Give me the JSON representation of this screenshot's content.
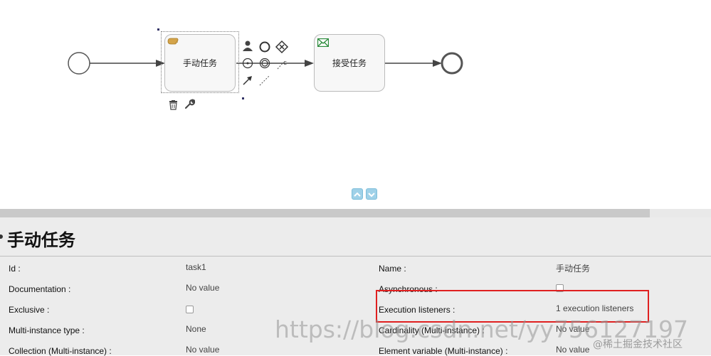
{
  "diagram": {
    "tasks": [
      {
        "id": "manual",
        "label": "手动任务"
      },
      {
        "id": "receive",
        "label": "接受任务"
      }
    ],
    "toolbar_icons": [
      "user-icon",
      "event-circle-icon",
      "gateway-icon",
      "intermediate-event-icon",
      "double-circle-icon",
      "text-annotation-icon",
      "sequence-arrow-icon",
      "association-icon"
    ],
    "below_icons": [
      "trash-icon",
      "wrench-icon"
    ]
  },
  "nav": {
    "up": "collapse-up-icon",
    "down": "expand-down-icon"
  },
  "properties": {
    "title": "手动任务",
    "left": [
      {
        "label": "Id :",
        "value": "task1"
      },
      {
        "label": "Documentation :",
        "value": "No value"
      },
      {
        "label": "Exclusive :",
        "value": ""
      },
      {
        "label": "Multi-instance type :",
        "value": "None"
      },
      {
        "label": "Collection (Multi-instance) :",
        "value": "No value"
      }
    ],
    "right": [
      {
        "label": "Name :",
        "value": "手动任务"
      },
      {
        "label": "Asynchronous :",
        "value": ""
      },
      {
        "label": "Execution listeners :",
        "value": "1 execution listeners"
      },
      {
        "label": "Cardinality (Multi-instance) :",
        "value": "No value"
      },
      {
        "label": "Element variable (Multi-instance) :",
        "value": "No value"
      }
    ]
  },
  "watermarks": {
    "url": "https://blog.csdn.net/yy756127197",
    "site": "@稀土掘金技术社区"
  }
}
